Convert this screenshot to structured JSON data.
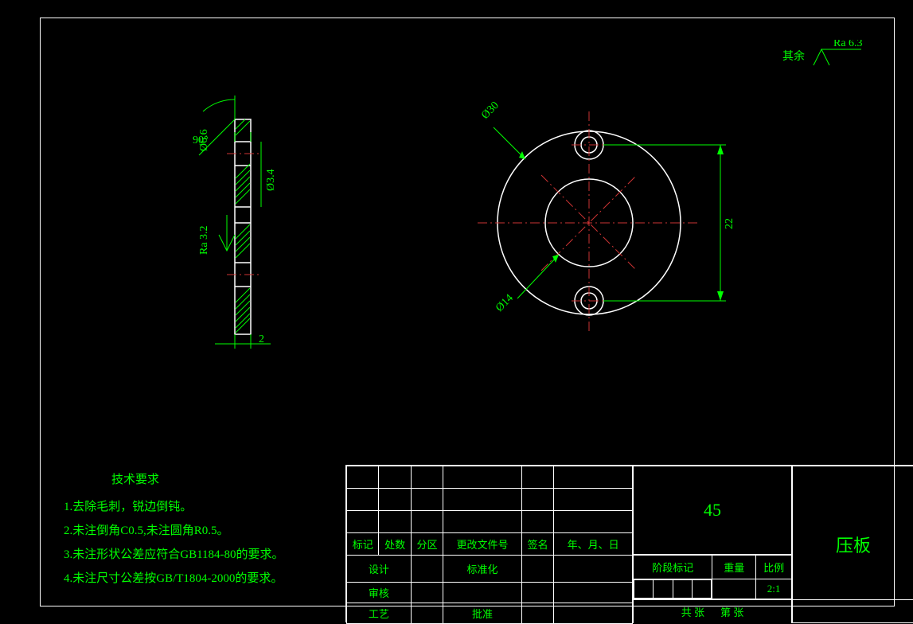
{
  "surface_finish": {
    "rest_label": "其余",
    "ra_value": "Ra 6.3",
    "side_ra": "Ra 3.2"
  },
  "dimensions": {
    "angle": "90°",
    "d_bore": "Ø6.6",
    "d_cbore": "Ø3.4",
    "thickness": "2",
    "d_outer": "Ø30",
    "d_inner": "Ø14",
    "bolt_spacing": "22"
  },
  "notes": {
    "title": "技术要求",
    "items": [
      "1.去除毛刺，锐边倒钝。",
      "2.未注倒角C0.5,未注圆角R0.5。",
      "3.未注形状公差应符合GB1184-80的要求。",
      "4.未注尺寸公差按GB/T1804-2000的要求。"
    ]
  },
  "title_block": {
    "material": "45",
    "part_name": "压板",
    "scale": "2:1",
    "labels": {
      "mark": "标记",
      "qty": "处数",
      "zone": "分区",
      "change_doc": "更改文件号",
      "sign": "签名",
      "date": "年、月、日",
      "design": "设计",
      "standardize": "标准化",
      "check": "审核",
      "process": "工艺",
      "approve": "批准",
      "stage_mark": "阶段标记",
      "weight": "重量",
      "ratio": "比例",
      "sheet_total": "共     张",
      "sheet_no": "第     张"
    }
  }
}
